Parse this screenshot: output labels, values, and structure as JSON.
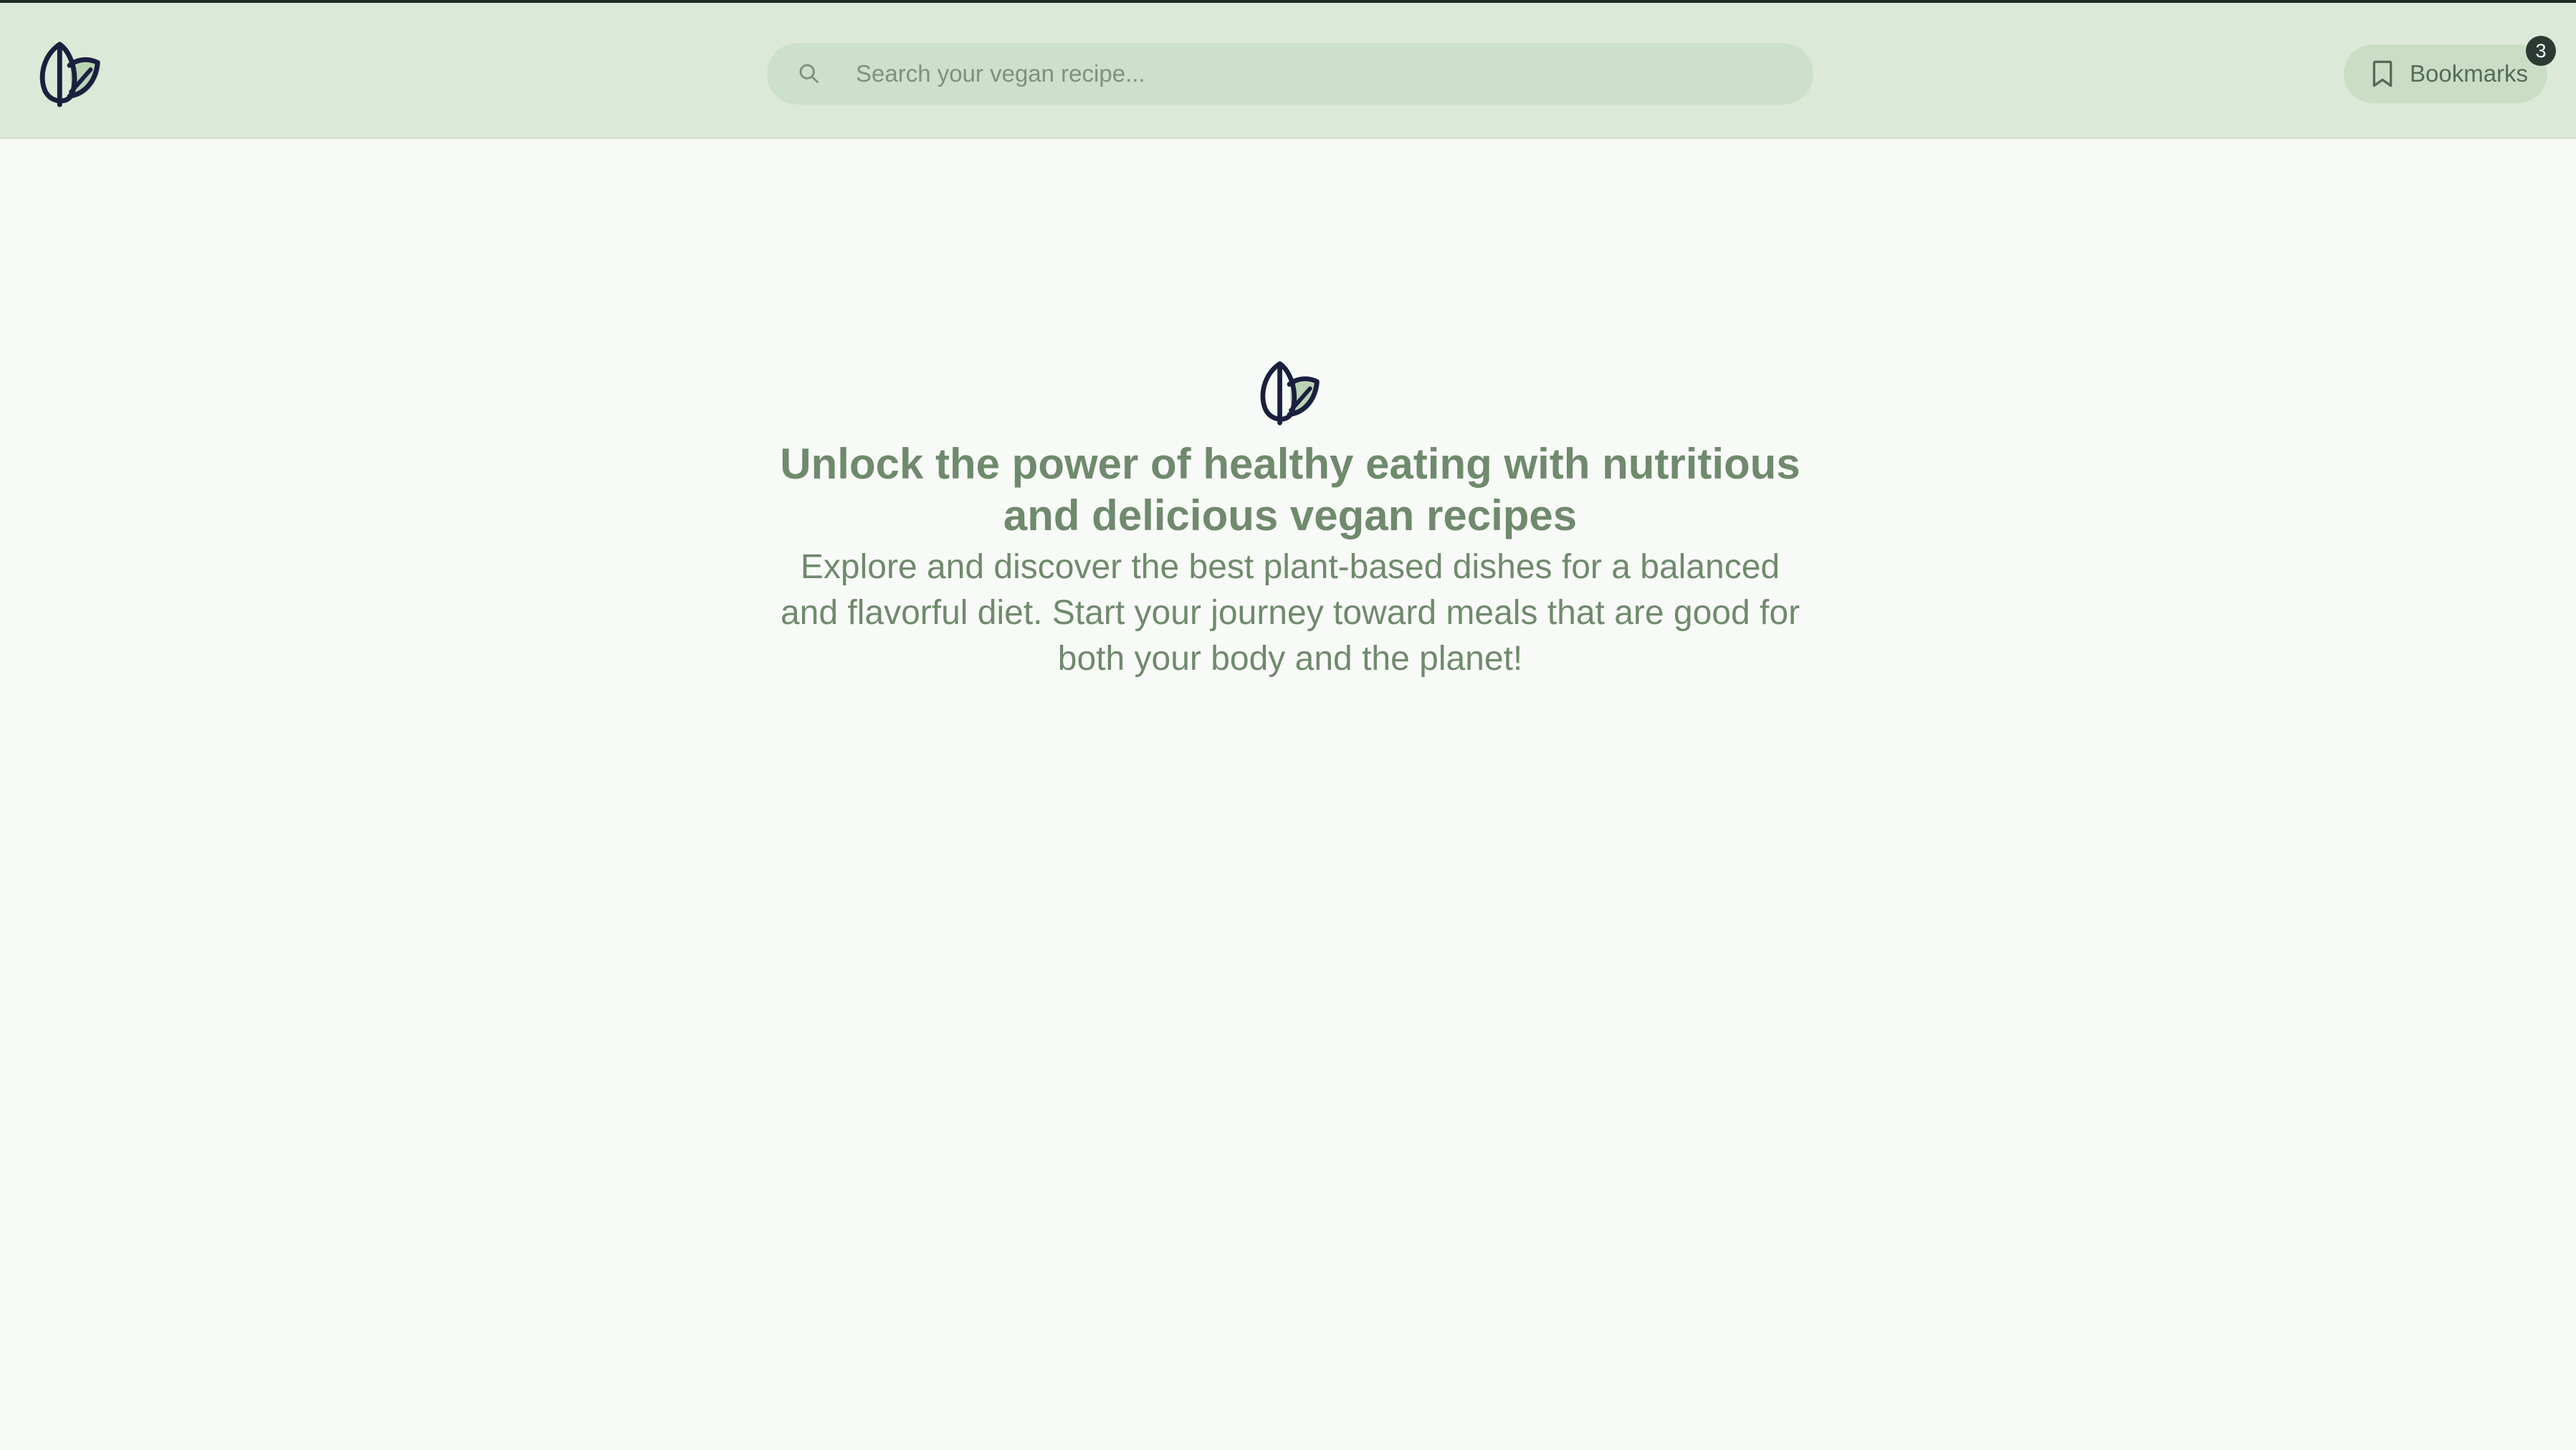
{
  "header": {
    "logo_icon": "leaf-logo-icon",
    "search": {
      "icon": "search-icon",
      "placeholder": "Search your vegan recipe...",
      "value": ""
    },
    "bookmarks": {
      "icon": "bookmark-icon",
      "label": "Bookmarks",
      "count": "3"
    }
  },
  "hero": {
    "icon": "leaf-logo-icon",
    "title_line1": "Unlock the power of healthy eating with nutritious",
    "title_line2": "and delicious vegan recipes",
    "text_line1": "Explore and discover the best plant-based dishes for a balanced",
    "text_line2": "and flavorful diet. Start your journey toward meals that are good for",
    "text_line3": "both your body and the planet!"
  },
  "colors": {
    "header_bg": "#dce9d8",
    "page_bg": "#f8faf7",
    "search_bg": "#cde0c9",
    "text_green": "#6f8a6c",
    "logo_dark": "#1b1f3f",
    "badge_bg": "#2b3a33"
  }
}
